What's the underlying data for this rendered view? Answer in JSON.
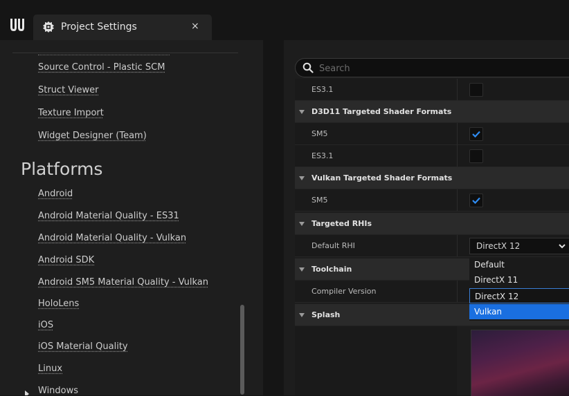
{
  "window": {
    "tab_title": "Project Settings",
    "close_glyph": "×"
  },
  "sidebar": {
    "items_top": [
      "Source Control - Plastic SCM",
      "Struct Viewer",
      "Texture Import",
      "Widget Designer (Team)"
    ],
    "section_heading": "Platforms",
    "items_platforms": [
      "Android",
      "Android Material Quality - ES31",
      "Android Material Quality - Vulkan",
      "Android SDK",
      "Android SM5 Material Quality - Vulkan",
      "HoloLens",
      "iOS",
      "iOS Material Quality",
      "Linux",
      "Windows"
    ]
  },
  "search": {
    "placeholder": "Search",
    "value": ""
  },
  "settings": {
    "es31_top_label": "ES3.1",
    "cat_d3d11": "D3D11 Targeted Shader Formats",
    "d3d11_sm5_label": "SM5",
    "d3d11_es31_label": "ES3.1",
    "cat_vulkan": "Vulkan Targeted Shader Formats",
    "vulkan_sm5_label": "SM5",
    "cat_rhis": "Targeted RHIs",
    "default_rhi_label": "Default RHI",
    "default_rhi_value": "DirectX 12",
    "cat_toolchain": "Toolchain",
    "compiler_version_label": "Compiler Version",
    "cat_splash": "Splash"
  },
  "checkbox_states": {
    "es31_top": false,
    "d3d11_sm5": true,
    "d3d11_es31": false,
    "vulkan_sm5": true
  },
  "dropdown_menu": {
    "options": [
      "Default",
      "DirectX 11",
      "DirectX 12",
      "Vulkan"
    ],
    "selected": "DirectX 12",
    "hovered": "Vulkan"
  },
  "colors": {
    "accent": "#1a6fe0",
    "checkmark": "#2f8cf2",
    "selected_border": "#3a7fd6"
  }
}
